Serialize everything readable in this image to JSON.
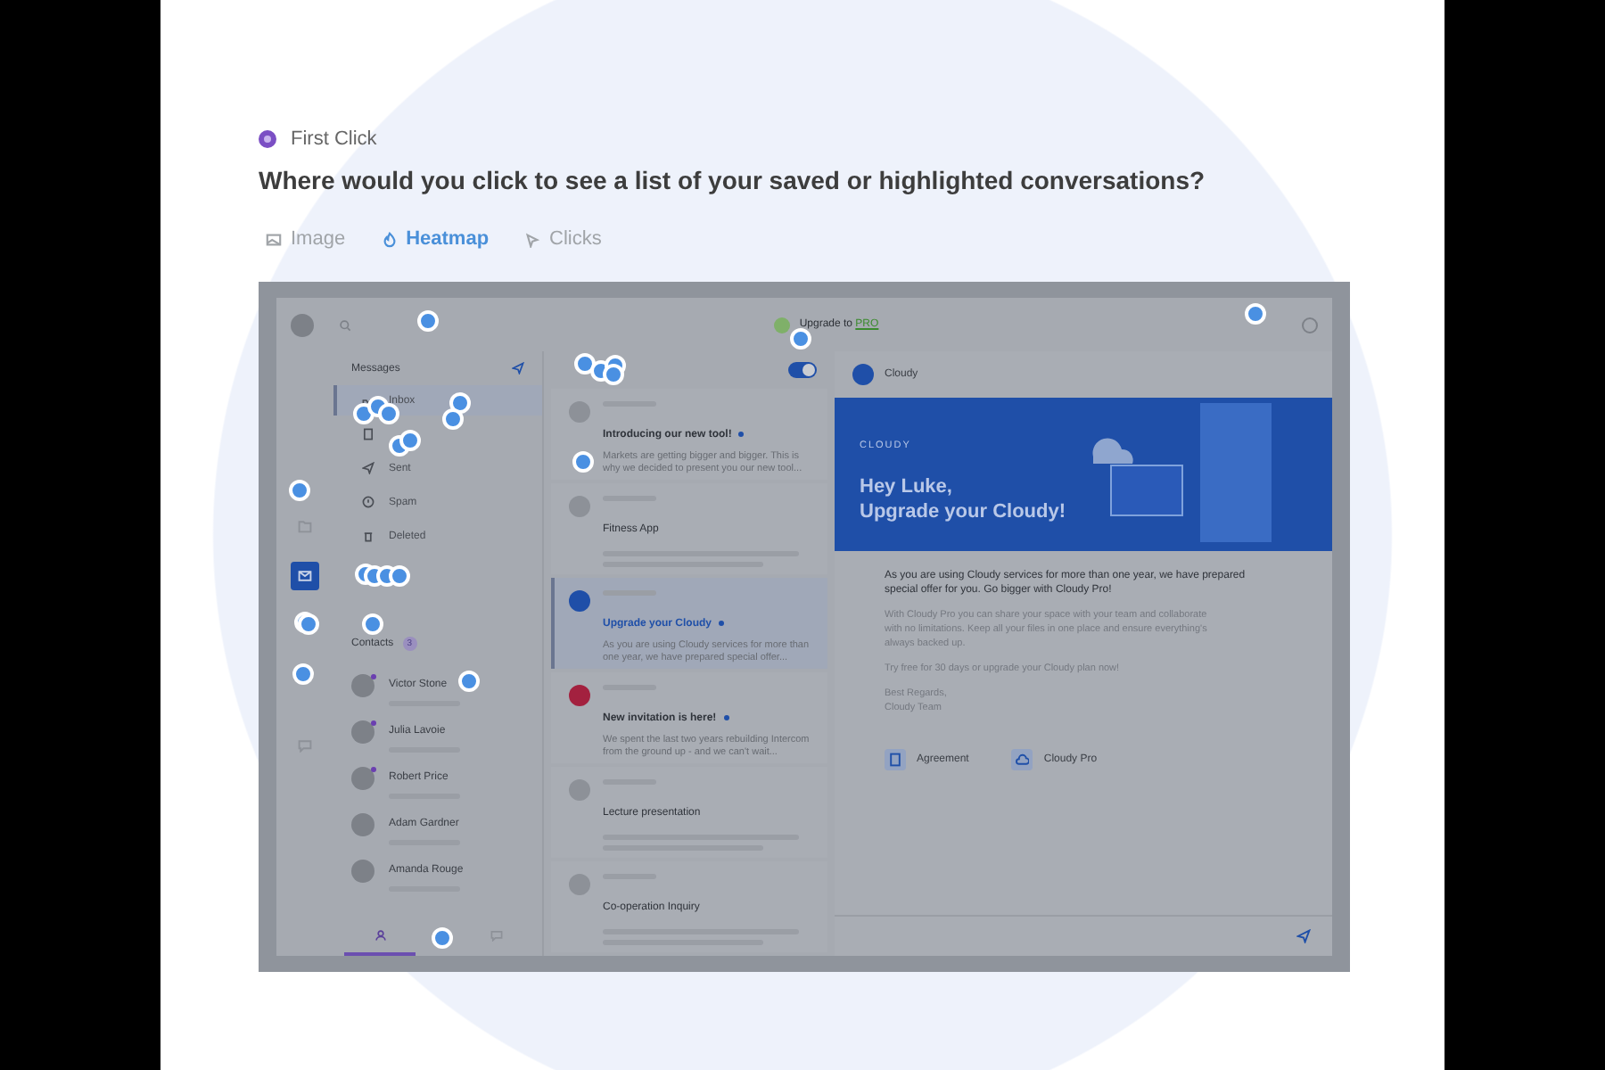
{
  "task": {
    "type_label": "First Click",
    "question": "Where would you click to see a list of your saved or highlighted conversations?"
  },
  "view_tabs": [
    {
      "label": "Image",
      "kind": "image",
      "selected": false
    },
    {
      "label": "Heatmap",
      "kind": "heatmap",
      "selected": true
    },
    {
      "label": "Clicks",
      "kind": "clicks",
      "selected": false
    }
  ],
  "screenshot": {
    "top_bar": {
      "upgrade_text": "Upgrade to",
      "upgrade_highlight": "PRO"
    },
    "rail_items": [
      {
        "kind": "folder",
        "selected": false
      },
      {
        "kind": "mail",
        "selected": true
      },
      {
        "kind": "chat",
        "selected": false
      }
    ],
    "messages_heading": "Messages",
    "folders": [
      {
        "label": "Inbox",
        "kind": "inbox",
        "selected": true
      },
      {
        "kind": "draft",
        "selected": false
      },
      {
        "label": "Sent",
        "kind": "sent",
        "selected": false
      },
      {
        "label": "Spam",
        "kind": "spam",
        "selected": false
      },
      {
        "label": "Deleted",
        "kind": "trash",
        "selected": false
      }
    ],
    "contacts_heading": "Contacts",
    "contacts_count": "3",
    "contacts": [
      {
        "name": "Victor Stone",
        "online": true
      },
      {
        "name": "Julia Lavoie",
        "online": true
      },
      {
        "name": "Robert Price",
        "online": true
      },
      {
        "name": "Adam Gardner",
        "online": false
      },
      {
        "name": "Amanda Rouge",
        "online": false
      }
    ],
    "bottom_tabs": [
      {
        "kind": "user",
        "selected": true
      },
      {
        "kind": "chat",
        "selected": false
      }
    ],
    "toggle": {
      "on": true
    },
    "messages": [
      {
        "title": "Introducing our new tool!",
        "preview": "Markets are getting bigger and bigger. This is why we decided to present you our new tool...",
        "unread": true,
        "selected": false
      },
      {
        "title": "Fitness App",
        "unread": false,
        "selected": false
      },
      {
        "title": "Upgrade your Cloudy",
        "preview": "As you are using Cloudy services for more than one year, we have prepared special offer...",
        "unread": true,
        "selected": true,
        "color": "#1f4fa8"
      },
      {
        "title": "New invitation is here!",
        "preview": "We spent the last two years rebuilding Intercom from the ground up - and we can't wait...",
        "unread": true,
        "selected": false,
        "color": "#a3213f"
      },
      {
        "title": "Lecture presentation",
        "unread": false,
        "selected": false
      },
      {
        "title": "Co-operation Inquiry",
        "unread": false,
        "selected": false
      }
    ],
    "reading": {
      "sender": "Cloudy",
      "banner_logo": "CLOUDY",
      "banner_line_1": "Hey Luke,",
      "banner_line_2": "Upgrade your Cloudy!",
      "lead": "As you are using Cloudy services for more than one year, we have prepared special offer for you. Go bigger with Cloudy Pro!",
      "paragraphs": [
        "With Cloudy Pro you can share your space with your team and collaborate with no limitations. Keep all your files in one place and ensure everything's always backed up.",
        "Try free for 30 days or upgrade your Cloudy plan now!"
      ],
      "signoff": [
        "Best Regards,",
        "Cloudy Team"
      ],
      "attachments": [
        {
          "name": "Agreement",
          "kind": "doc"
        },
        {
          "name": "Cloudy Pro",
          "kind": "cloud"
        }
      ]
    }
  }
}
